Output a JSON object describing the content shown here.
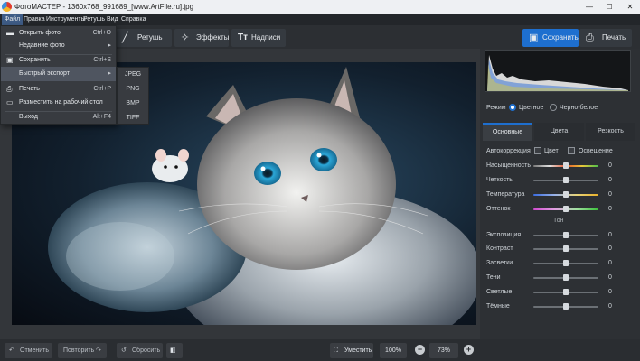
{
  "window": {
    "title": "ФотоМАСТЕР - 1360x768_991689_[www.ArtFile.ru].jpg"
  },
  "menu": [
    "Файл",
    "Правка",
    "Инструменты",
    "Ретушь",
    "Вид",
    "Справка"
  ],
  "toolbar": {
    "retouch": "Ретушь",
    "effects": "Эффекты",
    "captions": "Надписи",
    "save": "Сохранить",
    "print": "Печать"
  },
  "file_menu": {
    "items": [
      {
        "label": "Открыть фото",
        "shortcut": "Ctrl+O",
        "icon": "folder-icon"
      },
      {
        "label": "Недавние фото",
        "shortcut": "",
        "icon": ""
      },
      {
        "label": "Сохранить",
        "shortcut": "Ctrl+S",
        "icon": "save-icon"
      },
      {
        "label": "Быстрый экспорт",
        "shortcut": "",
        "icon": ""
      },
      {
        "label": "Печать",
        "shortcut": "Ctrl+P",
        "icon": "printer-icon"
      },
      {
        "label": "Разместить на рабочий стол",
        "shortcut": "",
        "icon": "monitor-icon"
      },
      {
        "label": "Выход",
        "shortcut": "Alt+F4",
        "icon": ""
      }
    ],
    "export_formats": [
      "JPEG",
      "PNG",
      "BMP",
      "TIFF"
    ]
  },
  "panel": {
    "mode_label": "Режим",
    "mode_color": "Цветное",
    "mode_bw": "Черно-белое",
    "tabs": [
      "Основные",
      "Цвета",
      "Резкость"
    ],
    "auto_label": "Автокоррекция",
    "auto_color": "Цвет",
    "auto_light": "Освещение",
    "tone_header": "Тон",
    "sliders_color": [
      {
        "label": "Насыщенность",
        "value": "0"
      },
      {
        "label": "Четкость",
        "value": "0"
      },
      {
        "label": "Температура",
        "value": "0"
      },
      {
        "label": "Оттенок",
        "value": "0"
      }
    ],
    "sliders_tone": [
      {
        "label": "Экспозиция",
        "value": "0"
      },
      {
        "label": "Контраст",
        "value": "0"
      },
      {
        "label": "Засветки",
        "value": "0"
      },
      {
        "label": "Тени",
        "value": "0"
      },
      {
        "label": "Светлые",
        "value": "0"
      },
      {
        "label": "Тёмные",
        "value": "0"
      }
    ]
  },
  "bottom": {
    "undo": "Отменить",
    "redo": "Повторить",
    "reset": "Сбросить",
    "fit": "Уместить",
    "zoom_100": "100%",
    "zoom_value": "73%"
  },
  "colors": {
    "accent": "#1e6fcf",
    "panel": "#2d3034",
    "background": "#2a2d31"
  }
}
